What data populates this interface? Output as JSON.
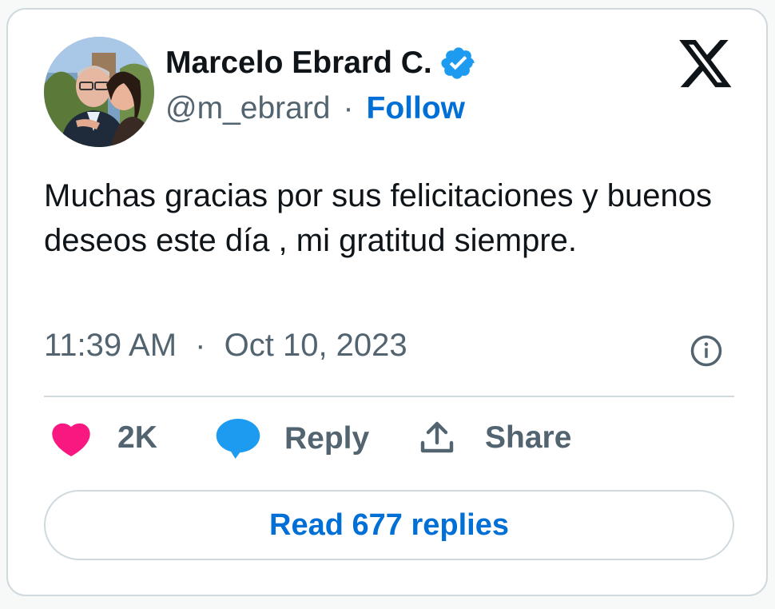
{
  "tweet": {
    "author": {
      "display_name": "Marcelo Ebrard C.",
      "handle": "@m_ebrard",
      "verified": true,
      "avatar_icon": "profile-photo"
    },
    "follow_label": "Follow",
    "separator": "·",
    "text": "Muchas gracias por sus felicitaciones y buenos deseos este día , mi gratitud siempre.",
    "time": "11:39 AM",
    "date": "Oct 10, 2023",
    "platform_logo": "x-logo"
  },
  "actions": {
    "like_count": "2K",
    "reply_label": "Reply",
    "share_label": "Share"
  },
  "read_replies_label": "Read 677 replies",
  "colors": {
    "accent": "#006fd6",
    "verified": "#1d9bf0",
    "like": "#f91880",
    "reply_icon": "#1d9bf0",
    "muted": "#536471",
    "border": "#cfd9de"
  }
}
